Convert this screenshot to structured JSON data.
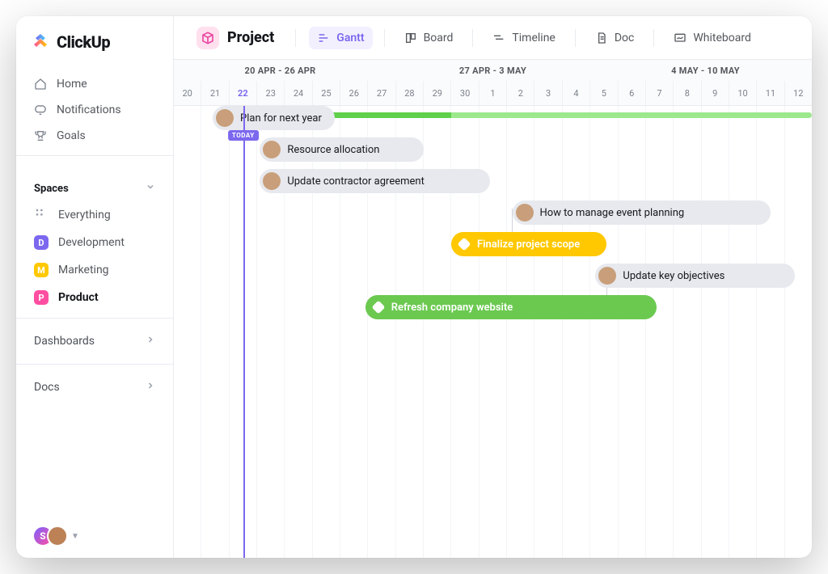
{
  "brand": "ClickUp",
  "sidebar": {
    "nav": [
      {
        "icon": "home",
        "label": "Home"
      },
      {
        "icon": "bell",
        "label": "Notifications"
      },
      {
        "icon": "trophy",
        "label": "Goals"
      }
    ],
    "spaces_header": "Spaces",
    "everything_label": "Everything",
    "spaces": [
      {
        "letter": "D",
        "color": "#7b68ee",
        "label": "Development",
        "active": false
      },
      {
        "letter": "M",
        "color": "#ffc800",
        "label": "Marketing",
        "active": false
      },
      {
        "letter": "P",
        "color": "#ff4ea1",
        "label": "Product",
        "active": true
      }
    ],
    "dashboards_label": "Dashboards",
    "docs_label": "Docs",
    "presence_initial": "S"
  },
  "header": {
    "project_label": "Project",
    "views": [
      {
        "id": "gantt",
        "label": "Gantt",
        "active": true
      },
      {
        "id": "board",
        "label": "Board",
        "active": false
      },
      {
        "id": "timeline",
        "label": "Timeline",
        "active": false
      },
      {
        "id": "doc",
        "label": "Doc",
        "active": false
      },
      {
        "id": "whiteboard",
        "label": "Whiteboard",
        "active": false
      }
    ]
  },
  "timeline": {
    "weeks": [
      "20 APR - 26 APR",
      "27 APR - 3 MAY",
      "4 MAY - 10 MAY"
    ],
    "days": [
      "20",
      "21",
      "22",
      "23",
      "24",
      "25",
      "26",
      "27",
      "28",
      "29",
      "30",
      "1",
      "2",
      "3",
      "4",
      "5",
      "6",
      "7",
      "8",
      "9",
      "10",
      "11",
      "12"
    ],
    "today_index": 2,
    "today_label": "TODAY"
  },
  "chart_data": {
    "type": "gantt",
    "date_range_start": "20 Apr",
    "date_range_end": "12 May",
    "total_columns": 23,
    "today": "22 Apr",
    "overall_progress_start_col": 1.5,
    "overall_progress_end_col": 23,
    "overall_progress_split_col": 10,
    "tasks": [
      {
        "id": "t1",
        "label": "Plan for next year",
        "style": "gray",
        "avatar": true,
        "row": 0,
        "start_col": 1.4,
        "end_col": 5.8
      },
      {
        "id": "t2",
        "label": "Resource allocation",
        "style": "gray",
        "avatar": true,
        "row": 1,
        "start_col": 3.1,
        "end_col": 9.0
      },
      {
        "id": "t3",
        "label": "Update contractor agreement",
        "style": "gray",
        "avatar": true,
        "row": 2,
        "start_col": 3.1,
        "end_col": 11.4
      },
      {
        "id": "t4",
        "label": "How to manage event planning",
        "style": "gray",
        "avatar": true,
        "row": 3,
        "start_col": 12.2,
        "end_col": 21.5
      },
      {
        "id": "t5",
        "label": "Finalize project scope",
        "style": "yellow",
        "diamond": true,
        "row": 4,
        "start_col": 10.0,
        "end_col": 15.6
      },
      {
        "id": "t6",
        "label": "Update key objectives",
        "style": "gray",
        "avatar": true,
        "row": 5,
        "start_col": 15.2,
        "end_col": 22.4
      },
      {
        "id": "t7",
        "label": "Refresh company website",
        "style": "green",
        "diamond": true,
        "row": 6,
        "start_col": 6.9,
        "end_col": 17.4
      }
    ],
    "dependencies": [
      {
        "from": "t3",
        "to": "t4"
      },
      {
        "from": "t5",
        "to": "t6"
      }
    ]
  }
}
